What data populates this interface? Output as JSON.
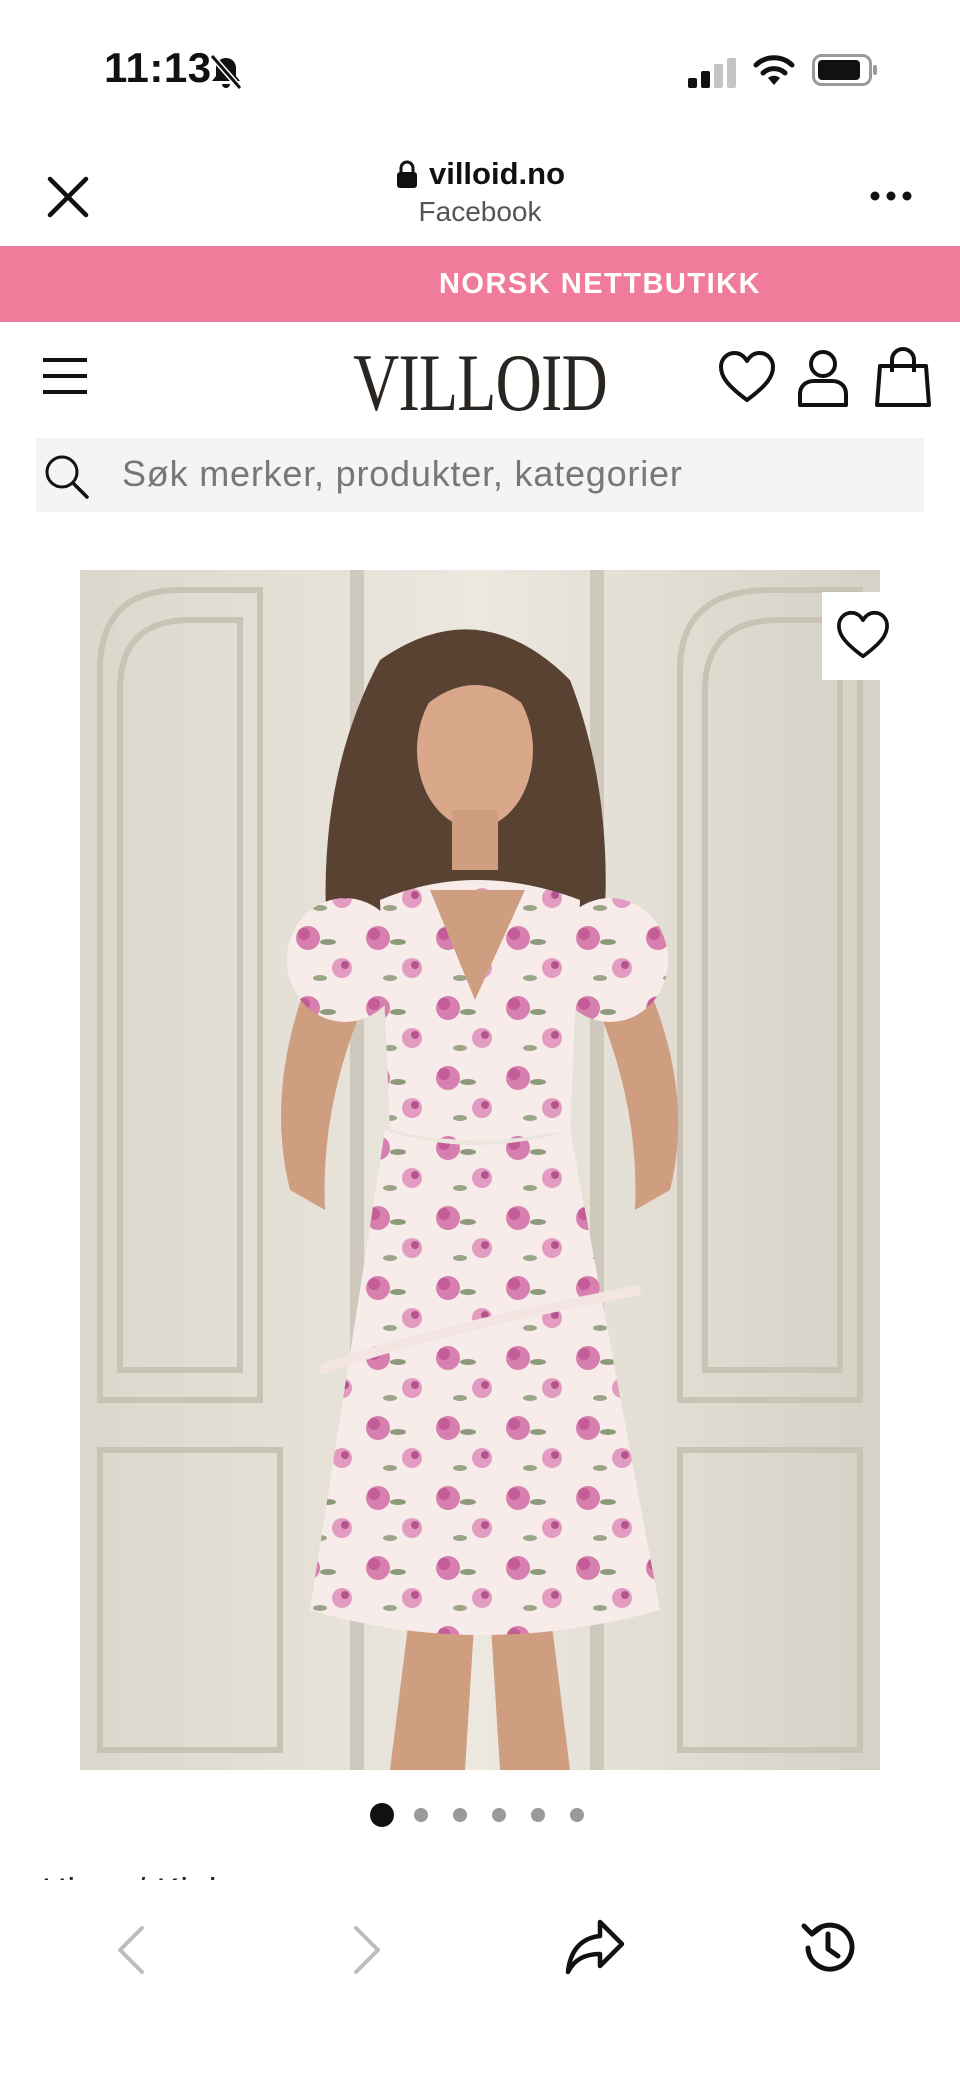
{
  "status_bar": {
    "time": "11:13"
  },
  "browser": {
    "domain": "villoid.no",
    "source": "Facebook"
  },
  "promo_banner": {
    "text": "NORSK NETTBUTIKK",
    "color": "#f07b9b"
  },
  "site": {
    "logo": "VILLOID"
  },
  "search": {
    "placeholder": "Søk merker, produkter, kategorier"
  },
  "carousel": {
    "total_images": 6,
    "active_index": 0
  },
  "breadcrumb": {
    "text": "Hjem / Kjoler"
  },
  "icons": {
    "status": [
      "bell-off-icon",
      "signal-icon",
      "wifi-icon",
      "battery-icon"
    ],
    "header": [
      "close-icon",
      "lock-icon",
      "more-icon"
    ],
    "site": [
      "menu-icon",
      "heart-icon",
      "user-icon",
      "bag-icon",
      "search-icon"
    ],
    "toolbar": [
      "back-icon",
      "forward-icon",
      "share-icon",
      "history-icon"
    ]
  }
}
